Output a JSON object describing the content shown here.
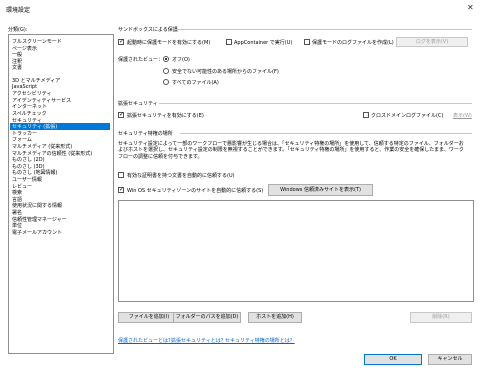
{
  "window": {
    "title": "環境設定",
    "close_icon": "close-icon"
  },
  "categories": {
    "label": "分類(G):",
    "selected_index": 16,
    "groups": [
      [
        "フルスクリーンモード",
        "ページ表示",
        "一般",
        "注釈",
        "文書"
      ],
      [
        "3D とマルチメディア",
        "JavaScript",
        "アクセシビリティ",
        "アイデンティティサービス",
        "インターネット",
        "スペルチェック",
        "セキュリティ",
        "セキュリティ (拡張)",
        "トラッカー",
        "フォーム",
        "マルチメディア (従来形式)",
        "マルチメディアの信頼性 (従来形式)",
        "ものさし (2D)",
        "ものさし (3D)",
        "ものさし (地図情報)",
        "ユーザー情報",
        "レビュー",
        "検索",
        "言語",
        "使用状況に関する情報",
        "署名",
        "信頼性管理マネージャー",
        "単位",
        "電子メールアカウント"
      ]
    ]
  },
  "sandbox": {
    "heading": "サンドボックスによる保護",
    "protected_mode_label": "起動時に保護モードを有効にする(M)",
    "protected_mode_checked": true,
    "appcontainer_label": "AppContainer で実行(U)",
    "appcontainer_checked": false,
    "log_label": "保護モードのログファイルを作成(L)",
    "log_checked": false,
    "view_log_button": "ログを表示(V)",
    "protected_view_label": "保護されたビュー：",
    "radio_off": "オフ(O)",
    "radio_unsafe": "安全でない可能性のある場所からのファイル(F)",
    "radio_all": "すべてのファイル(A)",
    "radio_selected": "off"
  },
  "enhanced": {
    "heading": "拡張セキュリティ",
    "enable_label": "拡張セキュリティを有効にする(E)",
    "enable_checked": true,
    "crossdomain_label": "クロスドメインログファイル(C)",
    "crossdomain_checked": false,
    "view_link": "表示(W)"
  },
  "privileged": {
    "heading": "セキュリティ特権の場所",
    "description": "セキュリティ設定によって一部のワークフローで悪影響が生じる場合は、「セキュリティ特権の場所」を使用して、信頼する特定のファイル、フォルダーおよびホストを選択し、セキュリティ設定の制限を無視することができます。「セキュリティ特権の場所」を使用すると、作業の安全を確保したまま、ワークフローの調整に信頼を付与できます。",
    "cert_label": "有効な証明書を持つ文書を自動的に信頼する(U)",
    "cert_checked": false,
    "win_label": "Win OS セキュリティゾーンのサイトを自動的に信頼する(S)",
    "win_checked": true,
    "show_sites_button": "Windows 信頼済みサイトを表示(T)",
    "add_file_button": "ファイルを追加(I)",
    "add_folder_button": "フォルダーのパスを追加(D)",
    "add_host_button": "ホストを追加(H)",
    "remove_button": "削除(R)"
  },
  "footer": {
    "link1": "保護されたビューとは？",
    "link2": "拡張セキュリティとは？",
    "link3": "セキュリティ特権の場所とは？",
    "ok_button": "OK",
    "cancel_button": "キャンセル"
  },
  "colors": {
    "selection": "#0078d7",
    "link": "#0066cc"
  }
}
